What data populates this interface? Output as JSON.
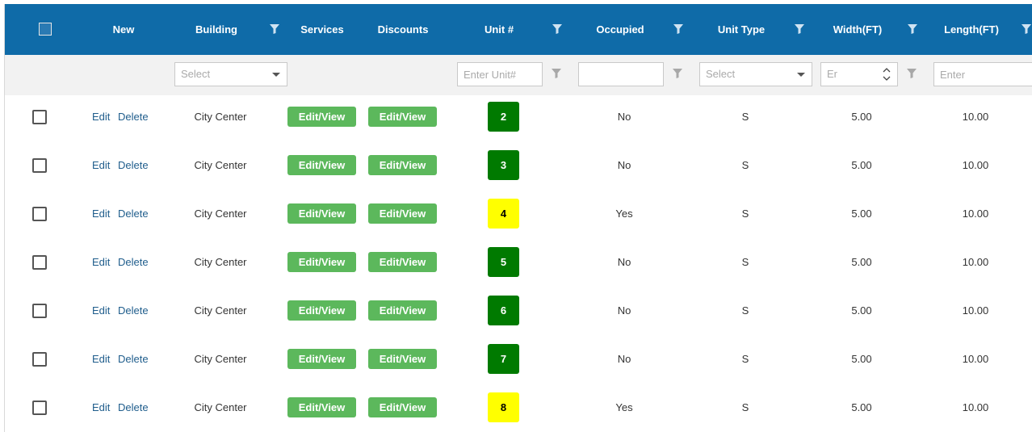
{
  "header": {
    "columns": {
      "new": "New",
      "building": "Building",
      "services": "Services",
      "discounts": "Discounts",
      "unit": "Unit #",
      "occupied": "Occupied",
      "unit_type": "Unit Type",
      "width": "Width(FT)",
      "length": "Length(FT)"
    }
  },
  "filters": {
    "building_placeholder": "Select",
    "unit_placeholder": "Enter Unit#",
    "occupied_value": "",
    "unit_type_placeholder": "Select",
    "width_placeholder": "Er",
    "length_placeholder": "Enter"
  },
  "actions": {
    "edit": "Edit",
    "delete": "Delete",
    "edit_view": "Edit/View"
  },
  "colors": {
    "header": "#0f6ba8",
    "button": "#5cb85c",
    "unit_free": "#007a00",
    "unit_occupied": "#ffff00"
  },
  "rows": [
    {
      "building": "City Center",
      "unit": "2",
      "occupied": "No",
      "unit_type": "S",
      "width": "5.00",
      "length": "10.00"
    },
    {
      "building": "City Center",
      "unit": "3",
      "occupied": "No",
      "unit_type": "S",
      "width": "5.00",
      "length": "10.00"
    },
    {
      "building": "City Center",
      "unit": "4",
      "occupied": "Yes",
      "unit_type": "S",
      "width": "5.00",
      "length": "10.00"
    },
    {
      "building": "City Center",
      "unit": "5",
      "occupied": "No",
      "unit_type": "S",
      "width": "5.00",
      "length": "10.00"
    },
    {
      "building": "City Center",
      "unit": "6",
      "occupied": "No",
      "unit_type": "S",
      "width": "5.00",
      "length": "10.00"
    },
    {
      "building": "City Center",
      "unit": "7",
      "occupied": "No",
      "unit_type": "S",
      "width": "5.00",
      "length": "10.00"
    },
    {
      "building": "City Center",
      "unit": "8",
      "occupied": "Yes",
      "unit_type": "S",
      "width": "5.00",
      "length": "10.00"
    }
  ]
}
